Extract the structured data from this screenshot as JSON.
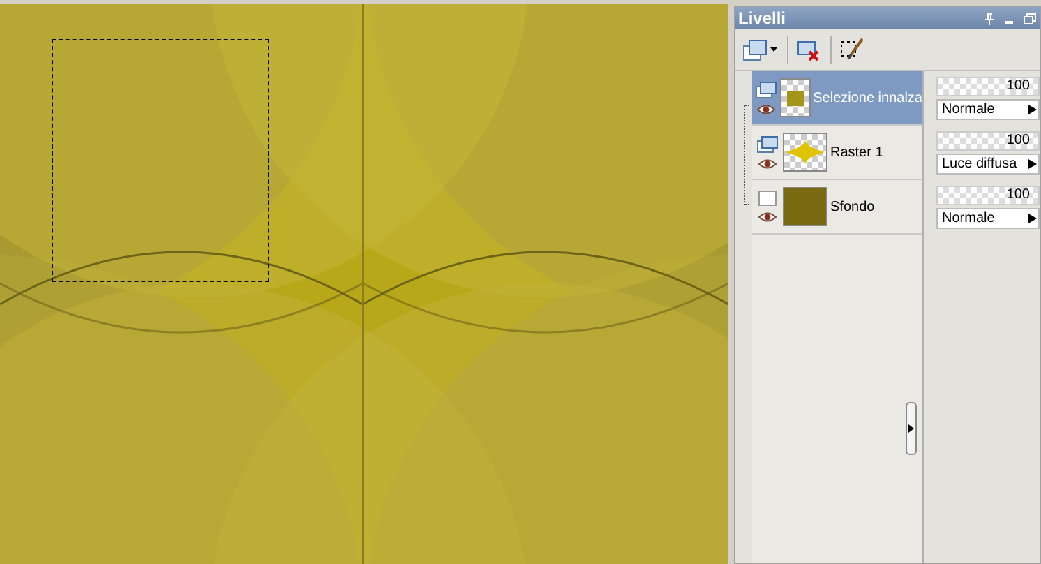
{
  "canvas": {
    "selection": true
  },
  "panel": {
    "title": "Livelli",
    "layers": [
      {
        "name": "Selezione innalza",
        "kind": "selection",
        "selected": true,
        "visible": true,
        "opacity": "100",
        "level": 1,
        "blend": "Normale"
      },
      {
        "name": "Raster 1",
        "kind": "raster",
        "selected": false,
        "visible": true,
        "opacity": "100",
        "level": 1,
        "blend": "Luce diffusa"
      },
      {
        "name": "Sfondo",
        "kind": "background",
        "selected": false,
        "visible": true,
        "opacity": "100",
        "level": 1,
        "blend": "Normale"
      }
    ]
  }
}
